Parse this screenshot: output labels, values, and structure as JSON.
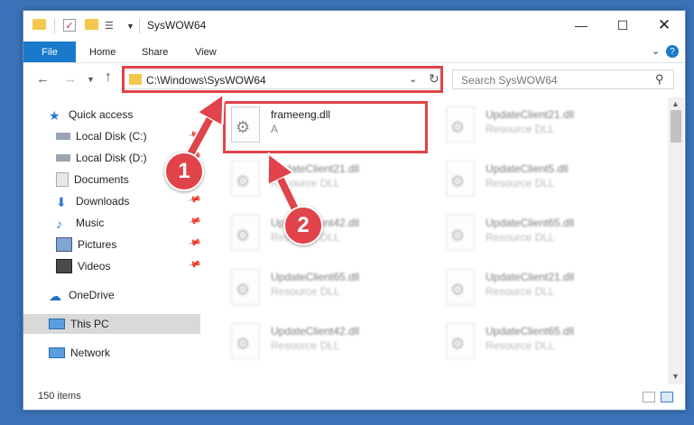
{
  "window": {
    "title": "SysWOW64"
  },
  "ribbon": {
    "file": "File",
    "home": "Home",
    "share": "Share",
    "view": "View",
    "help": "?"
  },
  "address": {
    "path": "C:\\Windows\\SysWOW64"
  },
  "search": {
    "placeholder": "Search SysWOW64"
  },
  "sidebar": {
    "items": [
      {
        "label": "Quick access"
      },
      {
        "label": "Local Disk (C:)"
      },
      {
        "label": "Local Disk (D:)"
      },
      {
        "label": "Documents"
      },
      {
        "label": "Downloads"
      },
      {
        "label": "Music"
      },
      {
        "label": "Pictures"
      },
      {
        "label": "Videos"
      },
      {
        "label": "OneDrive"
      },
      {
        "label": "This PC"
      },
      {
        "label": "Network"
      }
    ]
  },
  "files": [
    {
      "name": "frameeng.dll",
      "desc": "A"
    },
    {
      "name": "UpdateClient21.dll",
      "desc": "Resource DLL"
    },
    {
      "name": "UpdateClient21.dll",
      "desc": "Resource DLL"
    },
    {
      "name": "UpdateClient5.dll",
      "desc": "Resource DLL"
    },
    {
      "name": "UpdateClient42.dll",
      "desc": "Resource DLL"
    },
    {
      "name": "UpdateClient65.dll",
      "desc": "Resource DLL"
    },
    {
      "name": "UpdateClient65.dll",
      "desc": "Resource DLL"
    },
    {
      "name": "UpdateClient21.dll",
      "desc": "Resource DLL"
    },
    {
      "name": "UpdateClient42.dll",
      "desc": "Resource DLL"
    },
    {
      "name": "UpdateClient65.dll",
      "desc": "Resource DLL"
    }
  ],
  "status": {
    "items": "150 items"
  },
  "annotations": {
    "step1": "1",
    "step2": "2",
    "color": "#e0434a"
  }
}
